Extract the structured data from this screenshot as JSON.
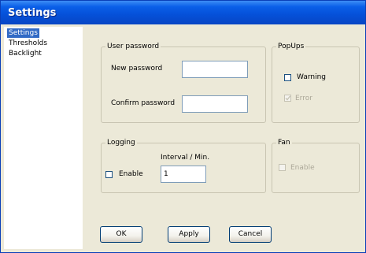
{
  "window": {
    "title": "Settings"
  },
  "sidebar": {
    "items": [
      {
        "label": "Settings"
      },
      {
        "label": "Thresholds"
      },
      {
        "label": "Backlight"
      }
    ]
  },
  "user_password": {
    "legend": "User password",
    "new_label": "New password",
    "new_value": "",
    "confirm_label": "Confirm password",
    "confirm_value": ""
  },
  "popups": {
    "legend": "PopUps",
    "warning_label": "Warning",
    "warning_checked": false,
    "error_label": "Error",
    "error_checked": true,
    "error_disabled": true
  },
  "logging": {
    "legend": "Logging",
    "interval_label": "Interval / Min.",
    "interval_value": "1",
    "enable_label": "Enable",
    "enable_checked": false
  },
  "fan": {
    "legend": "Fan",
    "enable_label": "Enable",
    "enable_checked": false,
    "enable_disabled": true
  },
  "buttons": {
    "ok": "OK",
    "apply": "Apply",
    "cancel": "Cancel"
  }
}
